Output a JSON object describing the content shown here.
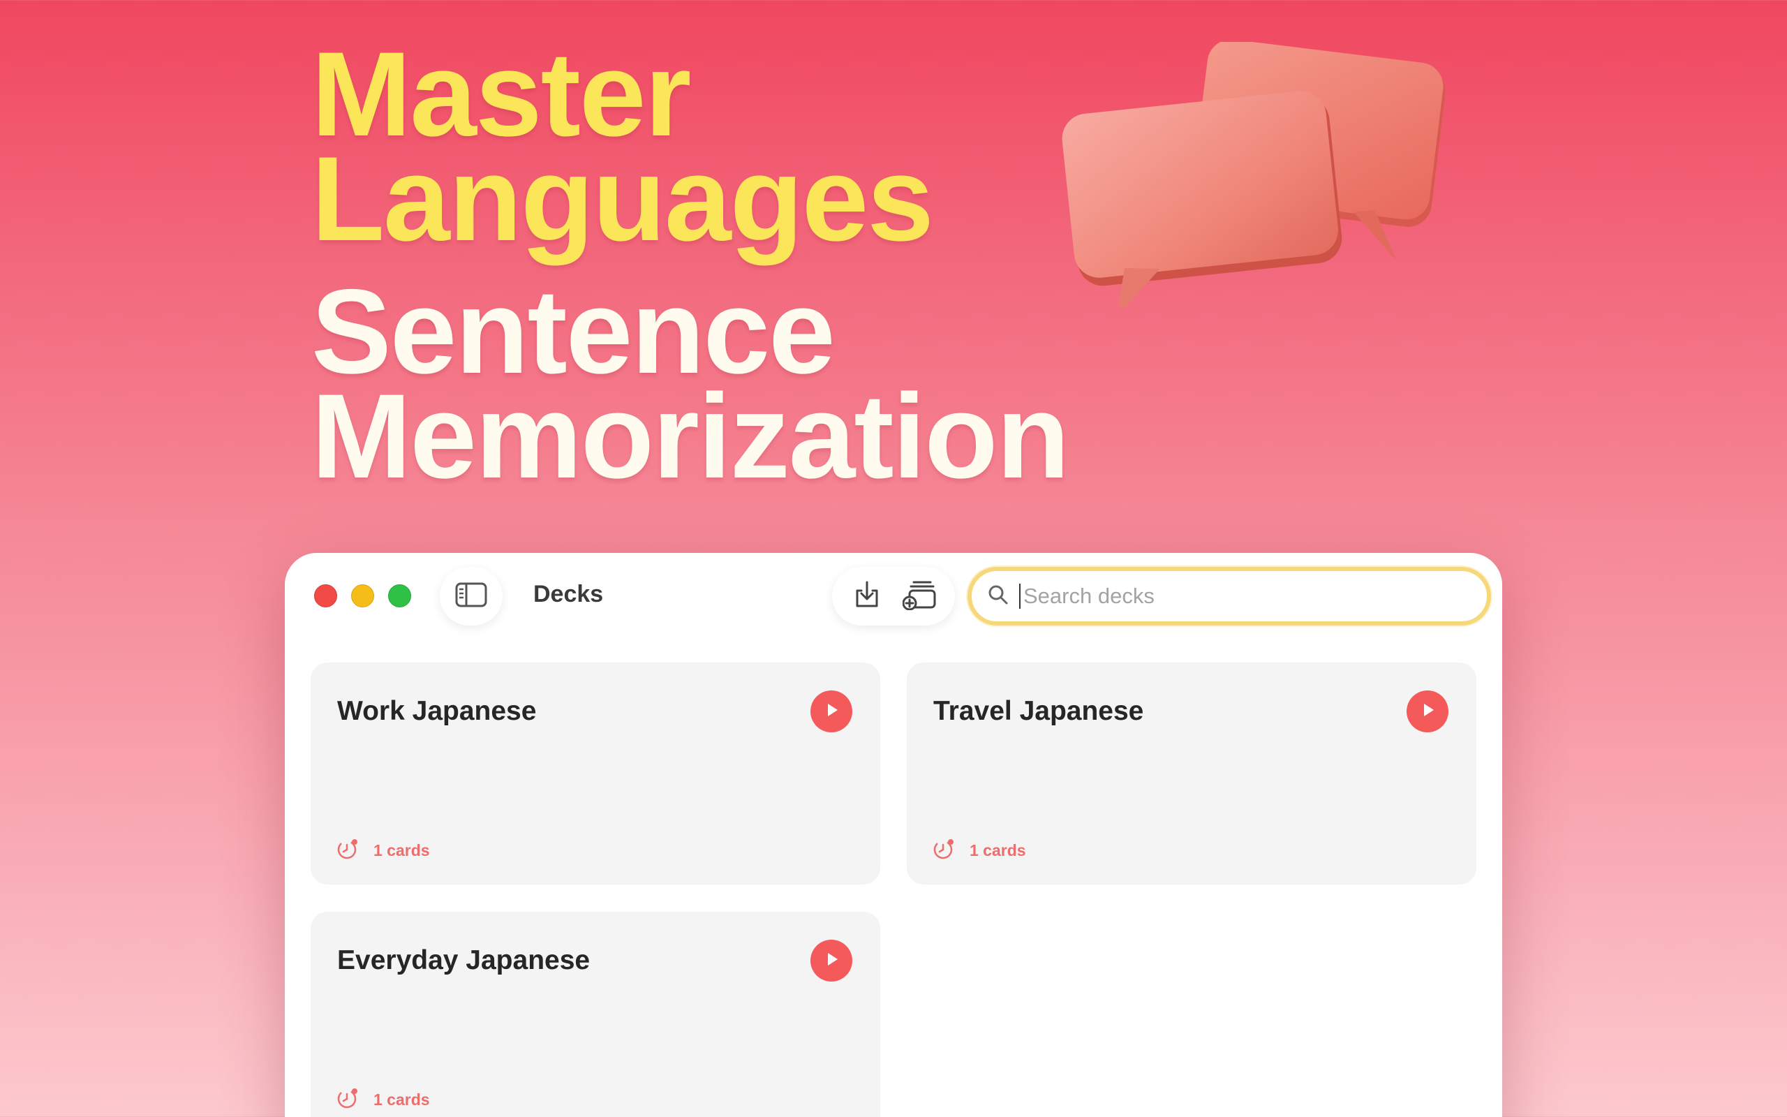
{
  "hero": {
    "line1": "Master",
    "line2": "Languages",
    "line3": "Sentence",
    "line4": "Memorization"
  },
  "window": {
    "title": "Decks",
    "search": {
      "placeholder": "Search decks",
      "value": ""
    }
  },
  "decks": [
    {
      "name": "Work Japanese",
      "count": "1 cards"
    },
    {
      "name": "Travel Japanese",
      "count": "1 cards"
    },
    {
      "name": "Everyday Japanese",
      "count": "1 cards"
    }
  ],
  "colors": {
    "accent": "#f45a5a",
    "headline_yellow": "#fbe65a",
    "search_focus": "#f6d77a"
  }
}
